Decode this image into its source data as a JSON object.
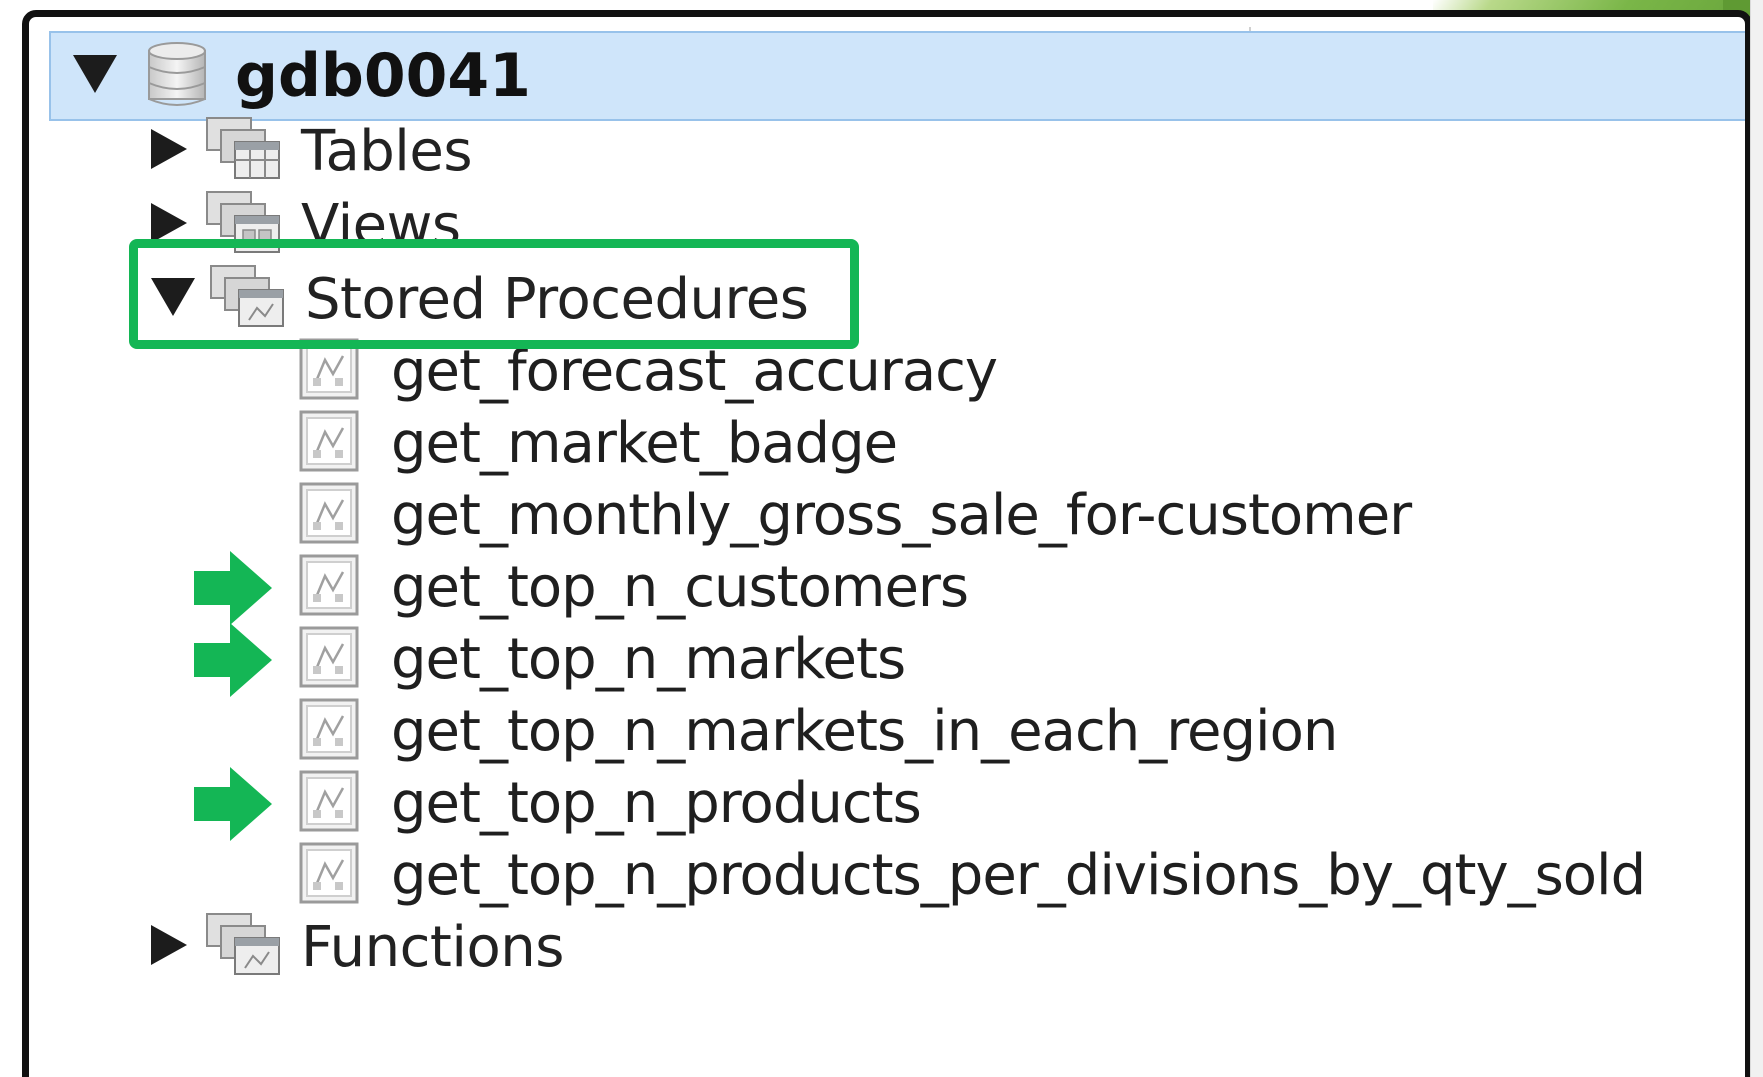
{
  "tree": {
    "root": {
      "label": "gdb0041",
      "icon": "database-icon",
      "expanded": true
    },
    "groups": [
      {
        "label": "Tables",
        "icon": "tables-folder-icon",
        "expanded": false
      },
      {
        "label": "Views",
        "icon": "views-folder-icon",
        "expanded": false
      },
      {
        "label": "Stored Procedures",
        "icon": "procedures-folder-icon",
        "expanded": true
      },
      {
        "label": "Functions",
        "icon": "functions-folder-icon",
        "expanded": false
      }
    ],
    "procedures": [
      {
        "label": "get_forecast_accuracy",
        "marked": false
      },
      {
        "label": "get_market_badge",
        "marked": false
      },
      {
        "label": "get_monthly_gross_sale_for-customer",
        "marked": false
      },
      {
        "label": "get_top_n_customers",
        "marked": true
      },
      {
        "label": "get_top_n_markets",
        "marked": true
      },
      {
        "label": "get_top_n_markets_in_each_region",
        "marked": false
      },
      {
        "label": "get_top_n_products",
        "marked": true
      },
      {
        "label": "get_top_n_products_per_divisions_by_qty_sold",
        "marked": false
      }
    ]
  },
  "colors": {
    "selection": "#cfe5fa",
    "highlight": "#14b655",
    "pointer": "#14b655"
  }
}
